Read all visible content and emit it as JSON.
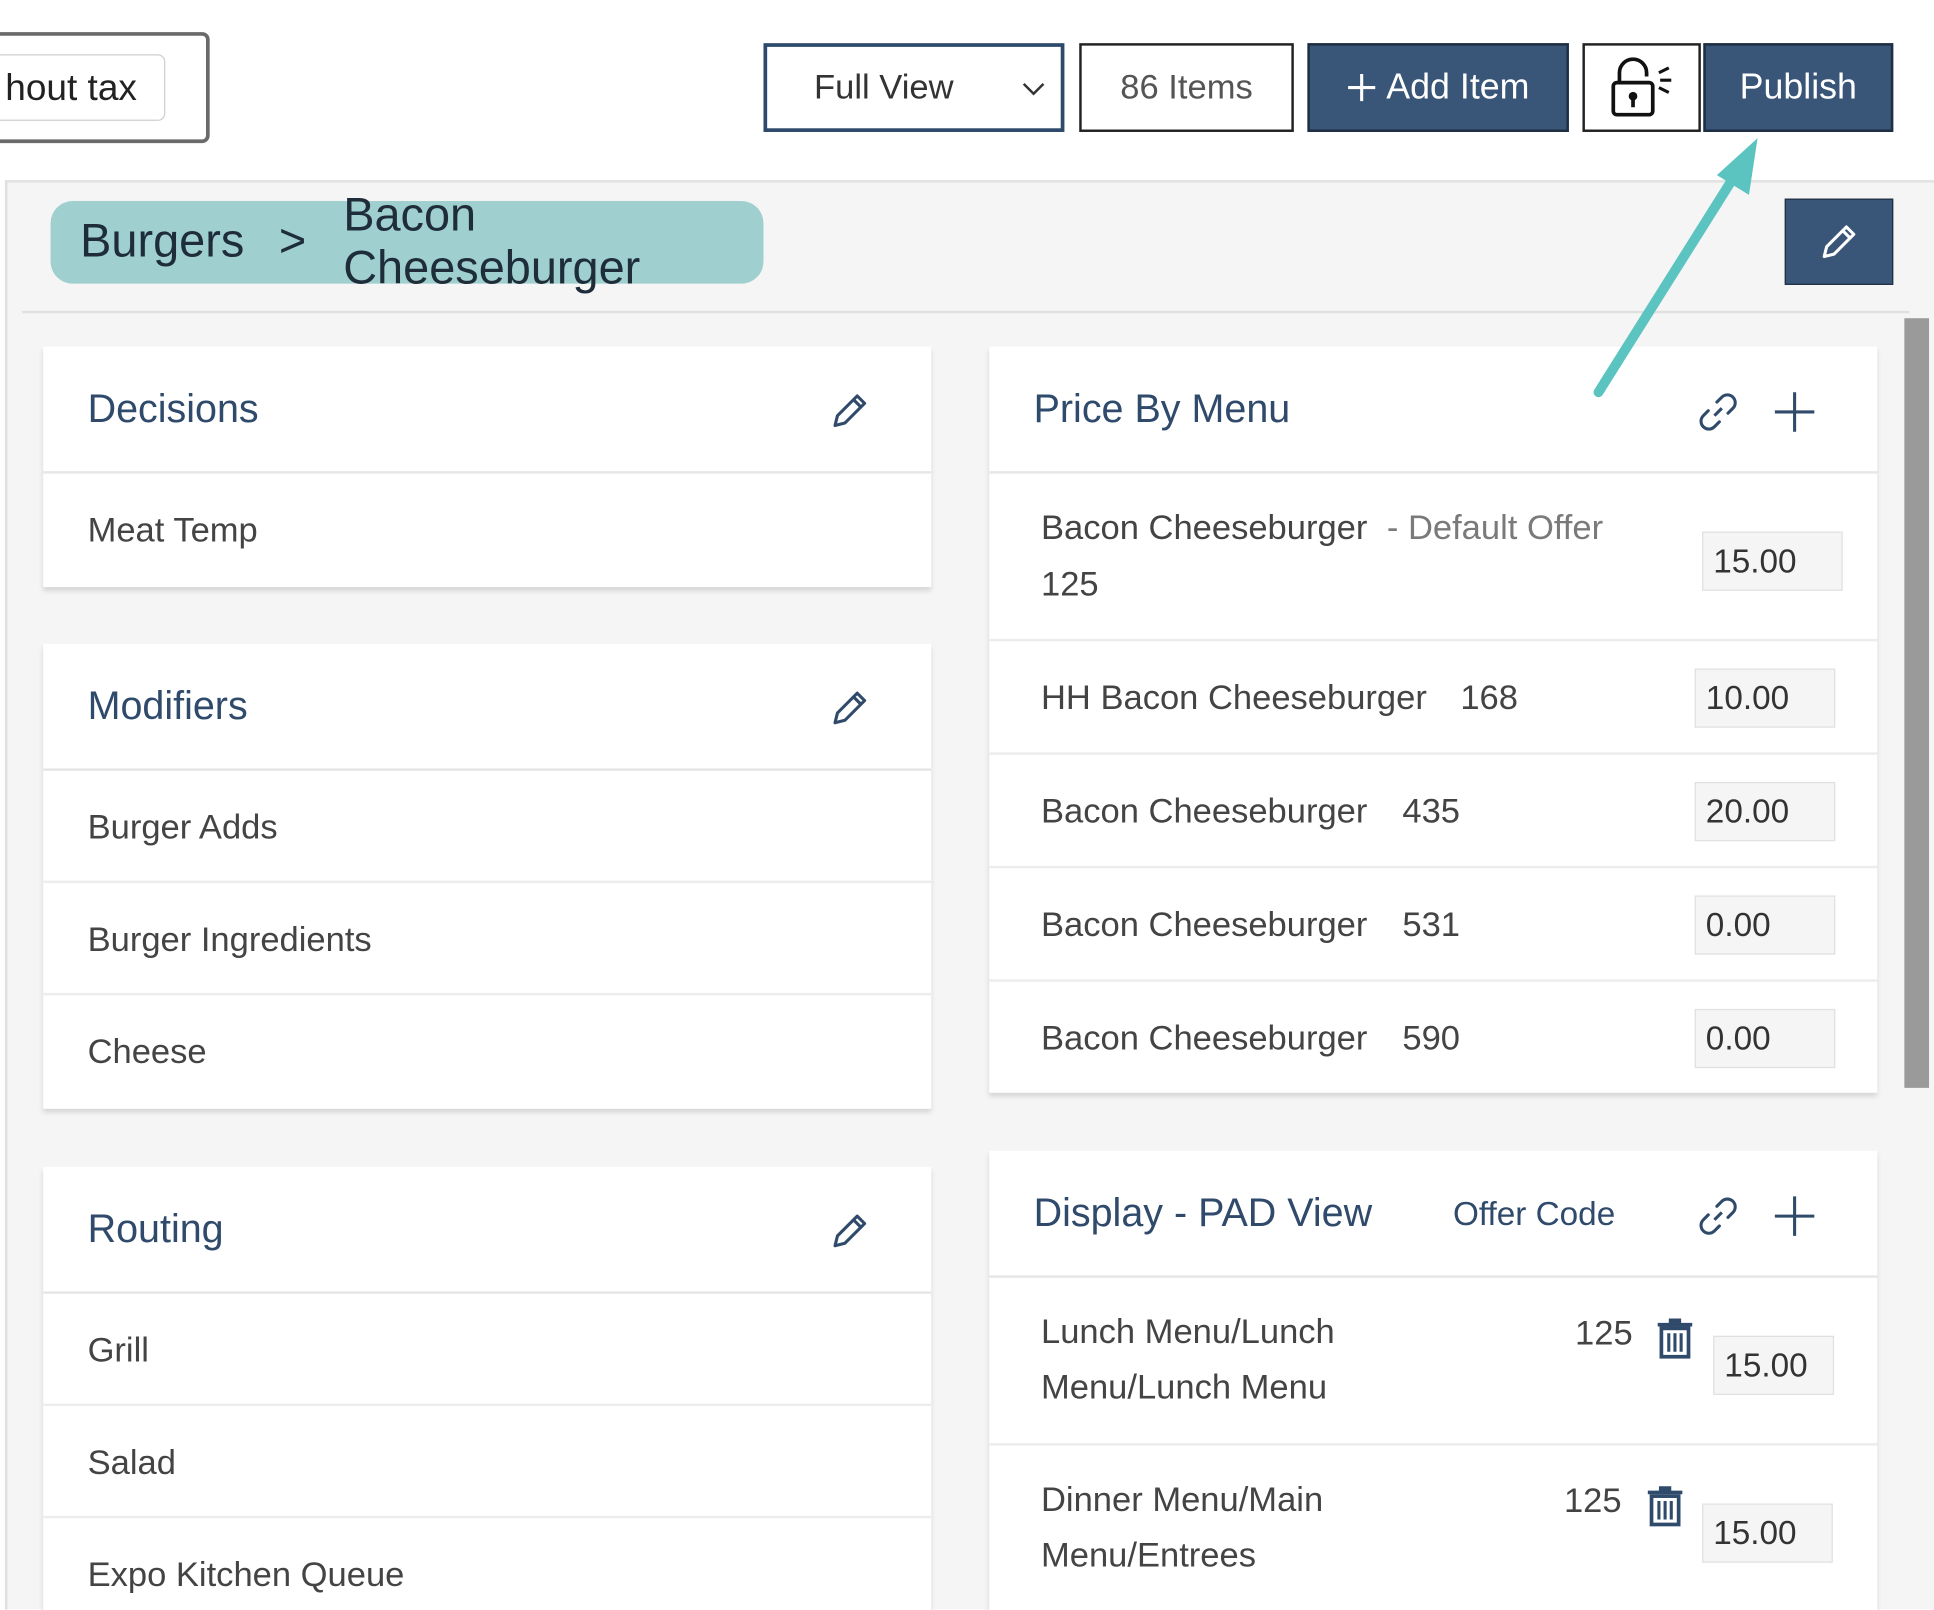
{
  "toolbar": {
    "tax_toggle_label": "hout tax",
    "view_select_value": "Full View",
    "item_count": "86 Items",
    "add_item_label": "Add Item",
    "publish_label": "Publish"
  },
  "breadcrumb": {
    "parent": "Burgers",
    "separator": ">",
    "current": "Bacon Cheeseburger"
  },
  "decisions": {
    "title": "Decisions",
    "items": [
      "Meat Temp"
    ]
  },
  "modifiers": {
    "title": "Modifiers",
    "items": [
      "Burger Adds",
      "Burger Ingredients",
      "Cheese"
    ]
  },
  "routing": {
    "title": "Routing",
    "items": [
      "Grill",
      "Salad",
      "Expo Kitchen Queue"
    ]
  },
  "price_by_menu": {
    "title": "Price By Menu",
    "rows": [
      {
        "name": "Bacon Cheeseburger",
        "tag": "- Default Offer",
        "code": "125",
        "price": "15.00"
      },
      {
        "name": "HH Bacon Cheeseburger",
        "code": "168",
        "price": "10.00"
      },
      {
        "name": "Bacon Cheeseburger",
        "code": "435",
        "price": "20.00"
      },
      {
        "name": "Bacon Cheeseburger",
        "code": "531",
        "price": "0.00"
      },
      {
        "name": "Bacon Cheeseburger",
        "code": "590",
        "price": "0.00"
      }
    ]
  },
  "display_pad": {
    "title": "Display - PAD View",
    "offer_code_label": "Offer Code",
    "rows": [
      {
        "line1": "Lunch Menu/Lunch",
        "line2": "Menu/Lunch Menu",
        "code": "125",
        "price": "15.00"
      },
      {
        "line1": "Dinner Menu/Main",
        "line2": "Menu/Entrees",
        "code": "125",
        "price": "15.00"
      }
    ]
  },
  "colors": {
    "navy": "#395577",
    "title_blue": "#2f4a6a",
    "breadcrumb_bg": "#9fcfcf",
    "arrow": "#5cc4c0"
  }
}
